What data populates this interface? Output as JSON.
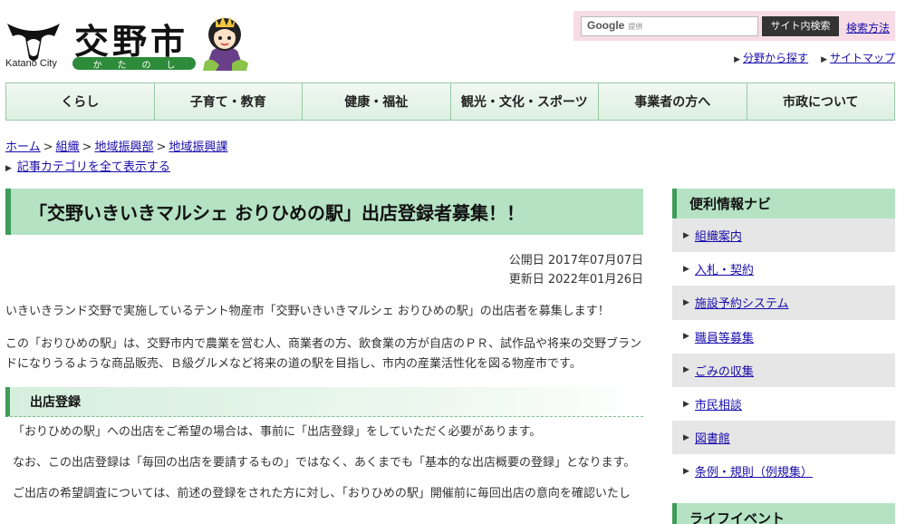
{
  "header": {
    "title": "交野市",
    "title_en": "Katano City",
    "kana": [
      "か",
      "た",
      "の",
      "し"
    ]
  },
  "search": {
    "brand": "Google",
    "brand_sub": "提供",
    "button_label": "サイト内検索",
    "help_label": "検索方法"
  },
  "util_links": [
    {
      "label": "分野から探す"
    },
    {
      "label": "サイトマップ"
    }
  ],
  "gnav": [
    {
      "label": "くらし"
    },
    {
      "label": "子育て・教育"
    },
    {
      "label": "健康・福祉"
    },
    {
      "label": "観光・文化・スポーツ"
    },
    {
      "label": "事業者の方へ"
    },
    {
      "label": "市政について"
    }
  ],
  "breadcrumb": {
    "items": [
      "ホーム",
      "組織",
      "地域振興部",
      "地域振興課"
    ],
    "separator": ">"
  },
  "category_link": "記事カテゴリを全て表示する",
  "article": {
    "title": "「交野いきいきマルシェ おりひめの駅」出店登録者募集！！",
    "published": "公開日 2017年07月07日",
    "updated": "更新日 2022年01月26日",
    "para1": "いきいきランド交野で実施しているテント物産市「交野いきいきマルシェ おりひめの駅」の出店者を募集します！",
    "para2": "この「おりひめの駅」は、交野市内で農業を営む人、商業者の方、飲食業の方が自店のＰＲ、試作品や将来の交野ブランドになりうるような商品販売、Ｂ級グルメなど将来の道の駅を目指し、市内の産業活性化を図る物産市です。",
    "section_heading": "出店登録",
    "para3": "「おりひめの駅」への出店をご希望の場合は、事前に「出店登録」をしていただく必要があります。",
    "para4": "なお、この出店登録は「毎回の出店を要請するもの」ではなく、あくまでも「基本的な出店概要の登録」となります。",
    "para5": "ご出店の希望調査については、前述の登録をされた方に対し、「おりひめの駅」開催前に毎回出店の意向を確認いたし"
  },
  "sidebar": {
    "title": "便利情報ナビ",
    "items": [
      {
        "label": "組織案内"
      },
      {
        "label": "入札・契約"
      },
      {
        "label": "施設予約システム"
      },
      {
        "label": "職員等募集"
      },
      {
        "label": "ごみの収集"
      },
      {
        "label": "市民相談"
      },
      {
        "label": "図書館"
      },
      {
        "label": "条例・規則（例規集）"
      }
    ],
    "title2": "ライフイベント"
  },
  "colors": {
    "accent_green": "#3f9c58",
    "title_bg": "#b4e2c3",
    "search_bg": "#f7dce6",
    "link": "#1a0dab"
  },
  "icons": [
    "city-crest-icon",
    "mascot-icon",
    "triangle-right-icon"
  ]
}
